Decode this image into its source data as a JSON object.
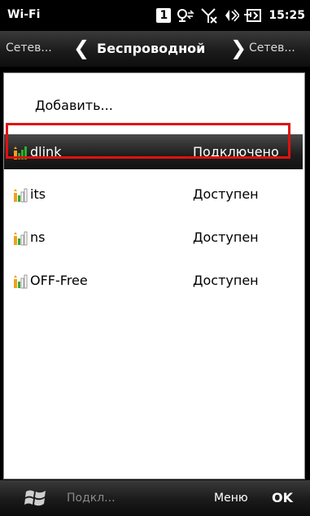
{
  "status_bar": {
    "title": "Wi-Fi",
    "badge": "1",
    "time": "15:25",
    "icons": [
      "notification-badge-icon",
      "data-sync-icon",
      "no-signal-icon",
      "volume-icon",
      "battery-charging-icon"
    ]
  },
  "nav": {
    "left_label": "Сетев...",
    "center_title": "Беспроводной",
    "right_label": "Сетев...",
    "prev_glyph": "❮",
    "next_glyph": "❯"
  },
  "list": {
    "add_label": "Добавить...",
    "networks": [
      {
        "name": "dlink",
        "status": "Подключено",
        "selected": true
      },
      {
        "name": "its",
        "status": "Доступен",
        "selected": false
      },
      {
        "name": "ns",
        "status": "Доступен",
        "selected": false
      },
      {
        "name": "OFF-Free",
        "status": "Доступен",
        "selected": false
      }
    ]
  },
  "bottom_bar": {
    "left_label": "Подкл...",
    "menu_label": "Меню",
    "ok_label": "OK"
  },
  "colors": {
    "highlight": "#e01010",
    "signal_green": "#2fae2f",
    "signal_orange": "#f0a020"
  }
}
